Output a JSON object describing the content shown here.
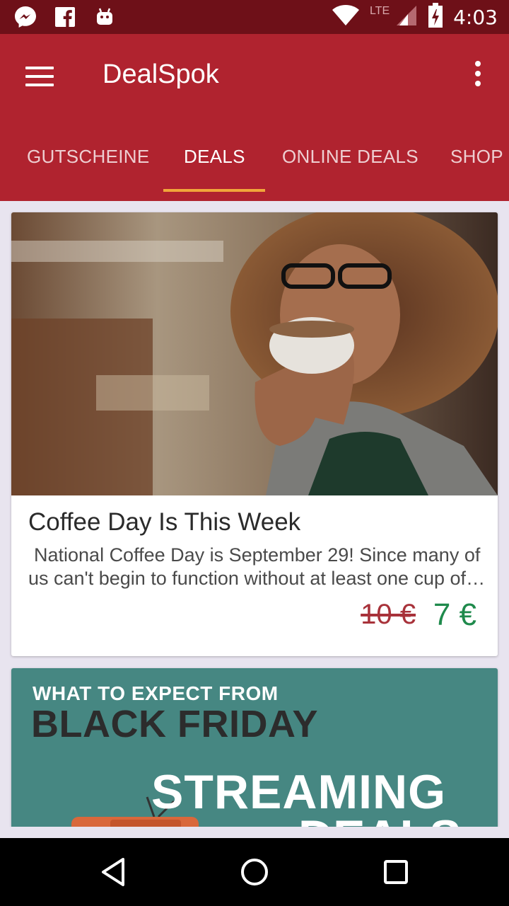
{
  "status_bar": {
    "icons": [
      "messenger-icon",
      "facebook-icon",
      "android-icon"
    ],
    "network": "LTE",
    "time": "4:03"
  },
  "app_bar": {
    "title": "DealSpok",
    "tabs": [
      {
        "label": "GUTSCHEINE",
        "active": false
      },
      {
        "label": "DEALS",
        "active": true
      },
      {
        "label": "ONLINE DEALS",
        "active": false
      },
      {
        "label": "SHOP",
        "active": false
      }
    ],
    "accent_color": "#b0232f",
    "indicator_color": "#f1a63a"
  },
  "deals": [
    {
      "image": "woman drinking coffee",
      "title": "Coffee Day Is This Week",
      "description": "National Coffee Day is September 29! Since many of us can't begin to function without at least one cup of coffee",
      "old_price": "10 €",
      "new_price": "7 €"
    },
    {
      "banner_line1": "WHAT TO EXPECT FROM",
      "banner_line2": "BLACK FRIDAY",
      "banner_line3": "STREAMING",
      "banner_line4": "DEALS"
    }
  ],
  "nav_bar": {
    "icons": [
      "back-icon",
      "home-icon",
      "recents-icon"
    ]
  }
}
